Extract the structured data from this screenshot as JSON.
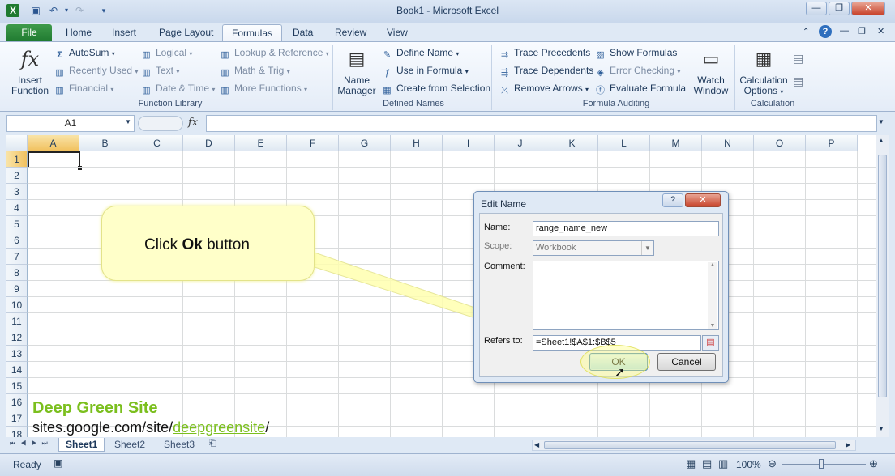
{
  "window": {
    "title": "Book1  -  Microsoft Excel",
    "minimize": "—",
    "maximize": "❐",
    "close": "✕"
  },
  "tabs": [
    "File",
    "Home",
    "Insert",
    "Page Layout",
    "Formulas",
    "Data",
    "Review",
    "View"
  ],
  "ribbon": {
    "insert_function": [
      "Insert",
      "Function"
    ],
    "function_library": {
      "col1": [
        "AutoSum",
        "Recently Used",
        "Financial"
      ],
      "col2": [
        "Logical",
        "Text",
        "Date & Time"
      ],
      "col3": [
        "Lookup & Reference",
        "Math & Trig",
        "More Functions"
      ],
      "label": "Function Library"
    },
    "name_manager": [
      "Name",
      "Manager"
    ],
    "defined_names": {
      "items": [
        "Define Name",
        "Use in Formula",
        "Create from Selection"
      ],
      "label": "Defined Names"
    },
    "formula_auditing": {
      "col1": [
        "Trace Precedents",
        "Trace Dependents",
        "Remove Arrows"
      ],
      "col2": [
        "Show Formulas",
        "Error Checking",
        "Evaluate Formula"
      ],
      "label": "Formula Auditing"
    },
    "watch_window": [
      "Watch",
      "Window"
    ],
    "calculation": {
      "options": [
        "Calculation",
        "Options"
      ],
      "label": "Calculation"
    }
  },
  "formula_bar": {
    "name_box": "A1",
    "fx": "fx",
    "value": ""
  },
  "grid": {
    "columns": [
      "A",
      "B",
      "C",
      "D",
      "E",
      "F",
      "G",
      "H",
      "I",
      "J",
      "K",
      "L",
      "M",
      "N",
      "O",
      "P"
    ],
    "rows": [
      "1",
      "2",
      "3",
      "4",
      "5",
      "6",
      "7",
      "8",
      "9",
      "10",
      "11",
      "12",
      "13",
      "14",
      "15",
      "16",
      "17",
      "18"
    ],
    "selected_cell": "A1"
  },
  "sheets": [
    "Sheet1",
    "Sheet2",
    "Sheet3"
  ],
  "status": {
    "mode": "Ready",
    "zoom": "100%"
  },
  "callout": {
    "prefix": "Click ",
    "bold": "Ok",
    "suffix": " button"
  },
  "dialog": {
    "title": "Edit Name",
    "name_label": "Name:",
    "name_value": "range_name_new",
    "scope_label": "Scope:",
    "scope_value": "Workbook",
    "comment_label": "Comment:",
    "refers_label": "Refers to:",
    "refers_value": "=Sheet1!$A$1:$B$5",
    "ok": "OK",
    "cancel": "Cancel"
  },
  "watermark": {
    "line1": "Deep Green Site",
    "line2_prefix": "sites.google.com/site/",
    "line2_link": "deepgreensite",
    "line2_suffix": "/"
  },
  "colors": {
    "file_tab": "#1f7a30",
    "accent_green": "#7bbf1e",
    "callout_fill": "#ffffc9"
  }
}
